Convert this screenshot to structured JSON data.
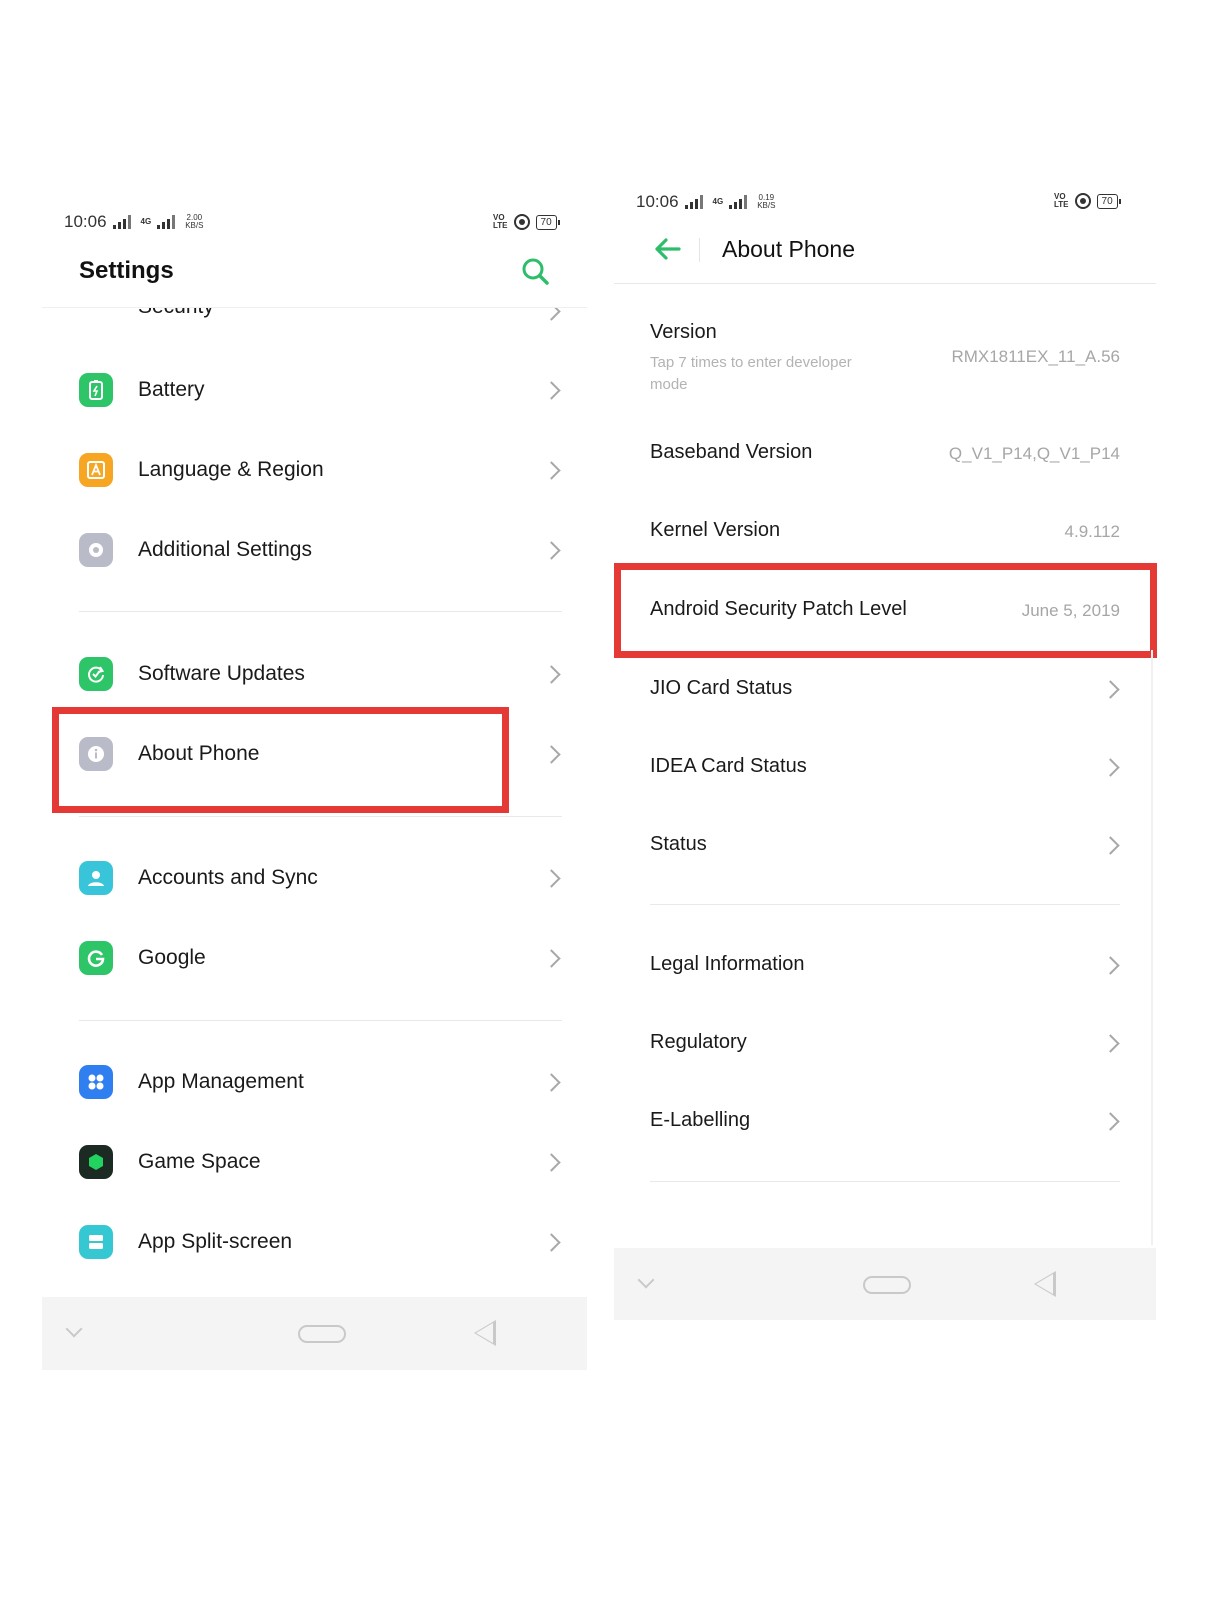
{
  "left": {
    "status": {
      "time": "10:06",
      "net_speed": "2.00",
      "net_unit": "KB/S",
      "net_type": "4G",
      "volte_top": "VO",
      "volte_bottom": "LTE",
      "battery": "70"
    },
    "title": "Settings",
    "rows": [
      {
        "label": "Security"
      },
      {
        "label": "Battery"
      },
      {
        "label": "Language & Region"
      },
      {
        "label": "Additional Settings"
      },
      {
        "label": "Software Updates"
      },
      {
        "label": "About Phone"
      },
      {
        "label": "Accounts and Sync"
      },
      {
        "label": "Google"
      },
      {
        "label": "App Management"
      },
      {
        "label": "Game Space"
      },
      {
        "label": "App Split-screen"
      }
    ]
  },
  "right": {
    "status": {
      "time": "10:06",
      "net_speed": "0.19",
      "net_unit": "KB/S",
      "net_type": "4G",
      "volte_top": "VO",
      "volte_bottom": "LTE",
      "battery": "70"
    },
    "title": "About Phone",
    "version": {
      "label": "Version",
      "sub": "Tap 7 times to enter developer mode",
      "value": "RMX1811EX_11_A.56"
    },
    "info": [
      {
        "label": "Baseband Version",
        "value": "Q_V1_P14,Q_V1_P14"
      },
      {
        "label": "Kernel Version",
        "value": "4.9.112"
      },
      {
        "label": "Android Security Patch Level",
        "value": "June 5, 2019"
      }
    ],
    "links1": [
      {
        "label": "JIO Card Status"
      },
      {
        "label": "IDEA Card Status"
      },
      {
        "label": "Status"
      }
    ],
    "links2": [
      {
        "label": "Legal Information"
      },
      {
        "label": "Regulatory"
      },
      {
        "label": "E-Labelling"
      }
    ]
  },
  "colors": {
    "accent": "#2ebd6b",
    "highlight": "#e53935"
  }
}
